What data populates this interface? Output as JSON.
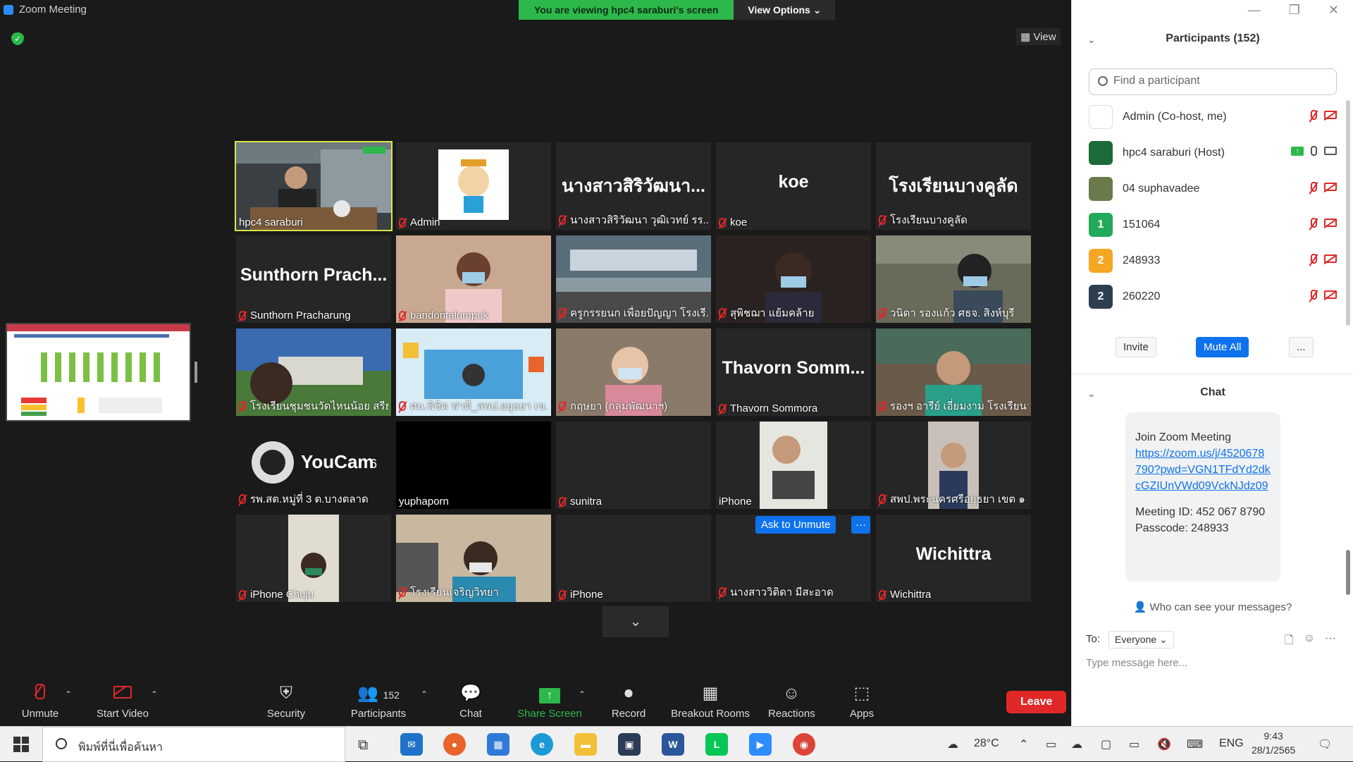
{
  "window": {
    "title": "Zoom Meeting"
  },
  "banner": {
    "message": "You are viewing hpc4 saraburi's screen",
    "view_options": "View Options ⌄"
  },
  "view_button": "View",
  "tiles": [
    {
      "name": "hpc4 saraburi",
      "big": "",
      "video": "presenter",
      "active": true,
      "muted": false
    },
    {
      "name": "Admin",
      "big": "",
      "video": "mascot",
      "muted": true
    },
    {
      "name": "นางสาวสิริวัฒนา วุฒิเวทย์ รร....",
      "big": "นางสาวสิริวัฒนา...",
      "muted": true
    },
    {
      "name": "koe",
      "big": "koe",
      "muted": true
    },
    {
      "name": "โรงเรียนบางคูลัด",
      "big": "โรงเรียนบางคูลัด",
      "muted": true
    },
    {
      "name": "Sunthorn Pracharung",
      "big": "Sunthorn Prach...",
      "muted": true
    },
    {
      "name": "bandontalumpuk",
      "big": "",
      "video": "person-warm",
      "muted": true
    },
    {
      "name": "ครูกรรยนก เพื่อยปัญญา โรงเรี...",
      "big": "",
      "video": "classroom",
      "muted": true
    },
    {
      "name": "สุพิชฌา แย้มคล้าย",
      "big": "",
      "video": "person-dark",
      "muted": true
    },
    {
      "name": "วนิดา รองแก้ว ศธจ. สิงห์บุรี",
      "big": "",
      "video": "office",
      "muted": true
    },
    {
      "name": "โรงเรียนชุมชนวัดไหนน้อย สรีย...",
      "big": "",
      "video": "school-sky",
      "muted": true
    },
    {
      "name": "ศน.พิชิต ฟาดี_สพป.อยุธยา เข...",
      "big": "",
      "video": "graphic",
      "muted": true
    },
    {
      "name": "กฤษยา (กลุ่มพัฒนาฯ)",
      "big": "",
      "video": "person-light",
      "muted": true
    },
    {
      "name": "Thavorn Sommora",
      "big": "Thavorn Somm...",
      "muted": true
    },
    {
      "name": "รองฯ อารีย์ เอี่ยมงาม โรงเรียนว...",
      "big": "",
      "video": "person-office",
      "muted": true
    },
    {
      "name": "รพ.สต.หมู่ที่ 3 ต.บางตลาด",
      "big": "",
      "video": "youcam",
      "muted": true
    },
    {
      "name": "yuphaporn",
      "big": "",
      "video": "black",
      "muted": false
    },
    {
      "name": "sunitra",
      "big": "",
      "muted": true
    },
    {
      "name": "iPhone",
      "big": "",
      "video": "portrait-rotated",
      "muted": false
    },
    {
      "name": "สพป.พระนครศรีอยุธยา เขต ๑",
      "big": "",
      "video": "portrait",
      "muted": true
    },
    {
      "name": "iPhone Chuju",
      "big": "",
      "video": "portrait-small",
      "muted": true
    },
    {
      "name": "โรงเรียนเจริญวิทยา",
      "big": "",
      "video": "person-desk",
      "muted": true
    },
    {
      "name": "iPhone",
      "big": "",
      "muted": true
    },
    {
      "name": "นางสาววิติดา มีสะอาด",
      "big": "",
      "ask_unmute": "Ask to Unmute",
      "more": "···",
      "muted": true
    },
    {
      "name": "Wichittra",
      "big": "Wichittra",
      "muted": true
    }
  ],
  "toolbar": {
    "unmute": "Unmute",
    "start_video": "Start Video",
    "security": "Security",
    "participants": "Participants",
    "participants_count": "152",
    "chat": "Chat",
    "share_screen": "Share Screen",
    "record": "Record",
    "breakout_rooms": "Breakout Rooms",
    "reactions": "Reactions",
    "apps": "Apps",
    "leave": "Leave"
  },
  "participants_panel": {
    "title": "Participants (152)",
    "search_placeholder": "Find a participant",
    "list": [
      {
        "name": "Admin (Co-host, me)",
        "avatar_color": "#ffffff",
        "avatar_text": "",
        "muted": true,
        "video_off": true
      },
      {
        "name": "hpc4 saraburi (Host)",
        "avatar_color": "#1d6b3a",
        "avatar_text": "",
        "sharing": true,
        "muted": false,
        "video_off": false
      },
      {
        "name": "04 suphavadee",
        "avatar_color": "#6b7a4a",
        "avatar_text": "",
        "muted": true,
        "video_off": true
      },
      {
        "name": "151064",
        "avatar_color": "#23a95a",
        "avatar_text": "1",
        "muted": true,
        "video_off": true
      },
      {
        "name": "248933",
        "avatar_color": "#f5a623",
        "avatar_text": "2",
        "muted": true,
        "video_off": true
      },
      {
        "name": "260220",
        "avatar_color": "#2d3e50",
        "avatar_text": "2",
        "muted": true,
        "video_off": true
      }
    ],
    "invite": "Invite",
    "mute_all": "Mute All",
    "more": "..."
  },
  "chat_panel": {
    "title": "Chat",
    "message_intro": "Join Zoom Meeting",
    "message_link": "https://zoom.us/j/4520678790?pwd=VGN1TFdYd2dkcGZIUnVWd09VckNJdz09",
    "meeting_id": "Meeting ID: 452 067 8790",
    "passcode": "Passcode: 248933",
    "who_can_see": "Who can see your messages?",
    "to_label": "To:",
    "to_value": "Everyone ⌄",
    "placeholder": "Type message here..."
  },
  "taskbar": {
    "search_placeholder": "พิมพ์ที่นี่เพื่อค้นหา",
    "temperature": "28°C",
    "language": "ENG",
    "time": "9:43",
    "date": "28/1/2565"
  }
}
